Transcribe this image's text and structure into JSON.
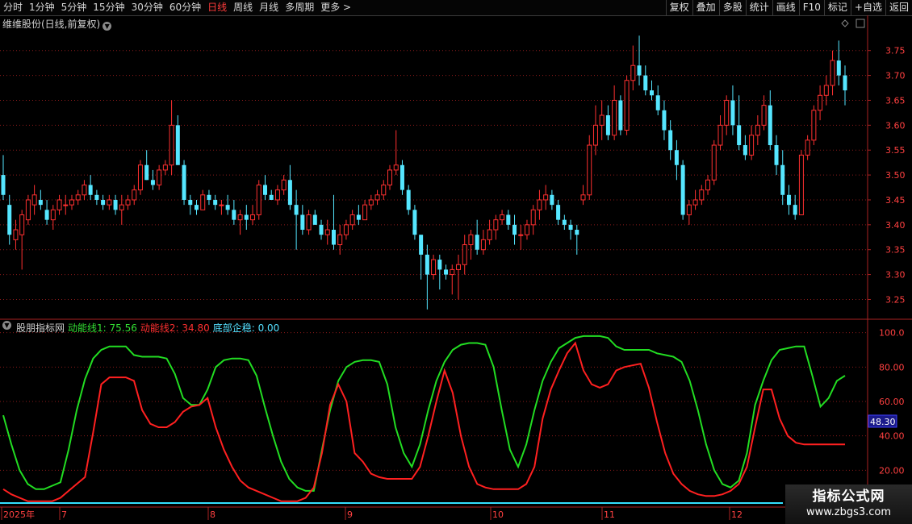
{
  "toolbar": {
    "periods": [
      "分时",
      "1分钟",
      "5分钟",
      "15分钟",
      "30分钟",
      "60分钟",
      "日线",
      "周线",
      "月线",
      "多周期",
      "更多 >"
    ],
    "active_period": "日线",
    "buttons": [
      "复权",
      "叠加",
      "多股",
      "统计",
      "画线",
      "F10",
      "标记",
      "+自选",
      "返回"
    ]
  },
  "main_chart": {
    "title": "维维股份(日线,前复权)",
    "y_ticks": [
      "3.75",
      "3.70",
      "3.65",
      "3.60",
      "3.55",
      "3.50",
      "3.45",
      "3.40",
      "3.35",
      "3.30",
      "3.25"
    ]
  },
  "indicator": {
    "name": "股朋指标网",
    "line1": "动能线1: 75.56",
    "line2": "动能线2: 34.80",
    "line3": "底部企稳: 0.00",
    "y_ticks": [
      "100.0",
      "80.00",
      "60.00",
      "40.00",
      "20.00"
    ],
    "cursor_value": "48.30"
  },
  "x_axis": {
    "labels": [
      "2025年",
      "7",
      "8",
      "9",
      "10",
      "11",
      "12"
    ]
  },
  "watermark": {
    "line1": "指标公式网",
    "line2": "www.zbgs3.com"
  },
  "colors": {
    "up": "#ff3030",
    "down": "#55e6ff",
    "line1": "#22dd22",
    "line2": "#ff2020",
    "line3": "#33e0ff",
    "grid": "#8a1a1a"
  },
  "chart_data": [
    {
      "type": "candlestick",
      "title": "维维股份(日线,前复权)",
      "ylim": [
        3.22,
        3.79
      ],
      "ohlc": [
        [
          3.5,
          3.54,
          3.45,
          3.46
        ],
        [
          3.44,
          3.46,
          3.36,
          3.38
        ],
        [
          3.37,
          3.41,
          3.35,
          3.39
        ],
        [
          3.38,
          3.43,
          3.31,
          3.42
        ],
        [
          3.41,
          3.46,
          3.4,
          3.45
        ],
        [
          3.44,
          3.48,
          3.42,
          3.46
        ],
        [
          3.45,
          3.47,
          3.43,
          3.44
        ],
        [
          3.43,
          3.45,
          3.4,
          3.41
        ],
        [
          3.41,
          3.44,
          3.39,
          3.43
        ],
        [
          3.43,
          3.46,
          3.42,
          3.45
        ],
        [
          3.44,
          3.46,
          3.42,
          3.44
        ],
        [
          3.44,
          3.46,
          3.43,
          3.45
        ],
        [
          3.45,
          3.47,
          3.44,
          3.46
        ],
        [
          3.46,
          3.49,
          3.45,
          3.48
        ],
        [
          3.48,
          3.5,
          3.45,
          3.46
        ],
        [
          3.46,
          3.47,
          3.44,
          3.45
        ],
        [
          3.45,
          3.46,
          3.43,
          3.44
        ],
        [
          3.44,
          3.46,
          3.43,
          3.45
        ],
        [
          3.45,
          3.46,
          3.42,
          3.43
        ],
        [
          3.43,
          3.46,
          3.4,
          3.44
        ],
        [
          3.44,
          3.46,
          3.43,
          3.45
        ],
        [
          3.45,
          3.48,
          3.44,
          3.47
        ],
        [
          3.47,
          3.53,
          3.46,
          3.52
        ],
        [
          3.52,
          3.55,
          3.49,
          3.49
        ],
        [
          3.49,
          3.51,
          3.47,
          3.48
        ],
        [
          3.48,
          3.52,
          3.47,
          3.51
        ],
        [
          3.51,
          3.53,
          3.5,
          3.52
        ],
        [
          3.52,
          3.65,
          3.5,
          3.6
        ],
        [
          3.6,
          3.62,
          3.52,
          3.52
        ],
        [
          3.52,
          3.53,
          3.44,
          3.45
        ],
        [
          3.45,
          3.46,
          3.42,
          3.44
        ],
        [
          3.44,
          3.45,
          3.42,
          3.43
        ],
        [
          3.43,
          3.47,
          3.43,
          3.46
        ],
        [
          3.46,
          3.47,
          3.44,
          3.45
        ],
        [
          3.45,
          3.46,
          3.43,
          3.44
        ],
        [
          3.44,
          3.45,
          3.42,
          3.44
        ],
        [
          3.44,
          3.46,
          3.42,
          3.43
        ],
        [
          3.43,
          3.45,
          3.4,
          3.41
        ],
        [
          3.41,
          3.43,
          3.38,
          3.42
        ],
        [
          3.42,
          3.44,
          3.39,
          3.41
        ],
        [
          3.41,
          3.44,
          3.4,
          3.42
        ],
        [
          3.42,
          3.49,
          3.41,
          3.48
        ],
        [
          3.48,
          3.5,
          3.45,
          3.46
        ],
        [
          3.46,
          3.47,
          3.45,
          3.45
        ],
        [
          3.45,
          3.48,
          3.44,
          3.47
        ],
        [
          3.47,
          3.5,
          3.46,
          3.49
        ],
        [
          3.49,
          3.52,
          3.43,
          3.44
        ],
        [
          3.44,
          3.47,
          3.35,
          3.42
        ],
        [
          3.42,
          3.44,
          3.38,
          3.39
        ],
        [
          3.39,
          3.43,
          3.38,
          3.42
        ],
        [
          3.42,
          3.43,
          3.4,
          3.4
        ],
        [
          3.4,
          3.41,
          3.37,
          3.38
        ],
        [
          3.38,
          3.41,
          3.36,
          3.39
        ],
        [
          3.39,
          3.46,
          3.35,
          3.36
        ],
        [
          3.36,
          3.4,
          3.34,
          3.38
        ],
        [
          3.38,
          3.41,
          3.37,
          3.4
        ],
        [
          3.4,
          3.43,
          3.39,
          3.42
        ],
        [
          3.42,
          3.44,
          3.4,
          3.41
        ],
        [
          3.41,
          3.45,
          3.41,
          3.44
        ],
        [
          3.44,
          3.46,
          3.43,
          3.45
        ],
        [
          3.45,
          3.47,
          3.44,
          3.46
        ],
        [
          3.46,
          3.49,
          3.45,
          3.48
        ],
        [
          3.48,
          3.52,
          3.47,
          3.51
        ],
        [
          3.51,
          3.59,
          3.5,
          3.52
        ],
        [
          3.52,
          3.53,
          3.46,
          3.47
        ],
        [
          3.47,
          3.48,
          3.42,
          3.43
        ],
        [
          3.43,
          3.44,
          3.37,
          3.38
        ],
        [
          3.38,
          3.38,
          3.29,
          3.34
        ],
        [
          3.34,
          3.36,
          3.23,
          3.3
        ],
        [
          3.3,
          3.34,
          3.29,
          3.33
        ],
        [
          3.33,
          3.34,
          3.27,
          3.31
        ],
        [
          3.31,
          3.32,
          3.29,
          3.3
        ],
        [
          3.3,
          3.32,
          3.26,
          3.31
        ],
        [
          3.31,
          3.34,
          3.25,
          3.32
        ],
        [
          3.32,
          3.38,
          3.3,
          3.36
        ],
        [
          3.36,
          3.39,
          3.33,
          3.38
        ],
        [
          3.38,
          3.41,
          3.34,
          3.35
        ],
        [
          3.35,
          3.39,
          3.34,
          3.37
        ],
        [
          3.37,
          3.41,
          3.36,
          3.39
        ],
        [
          3.39,
          3.42,
          3.37,
          3.41
        ],
        [
          3.41,
          3.43,
          3.4,
          3.42
        ],
        [
          3.42,
          3.43,
          3.39,
          3.4
        ],
        [
          3.4,
          3.42,
          3.36,
          3.38
        ],
        [
          3.38,
          3.4,
          3.35,
          3.38
        ],
        [
          3.38,
          3.41,
          3.37,
          3.4
        ],
        [
          3.4,
          3.44,
          3.38,
          3.43
        ],
        [
          3.43,
          3.47,
          3.41,
          3.45
        ],
        [
          3.45,
          3.48,
          3.43,
          3.46
        ],
        [
          3.46,
          3.47,
          3.43,
          3.44
        ],
        [
          3.44,
          3.45,
          3.4,
          3.41
        ],
        [
          3.41,
          3.42,
          3.39,
          3.4
        ],
        [
          3.4,
          3.41,
          3.37,
          3.39
        ],
        [
          3.39,
          3.4,
          3.34,
          3.38
        ],
        [
          3.45,
          3.48,
          3.44,
          3.46
        ],
        [
          3.46,
          3.58,
          3.45,
          3.56
        ],
        [
          3.56,
          3.64,
          3.54,
          3.6
        ],
        [
          3.6,
          3.65,
          3.57,
          3.62
        ],
        [
          3.62,
          3.64,
          3.57,
          3.58
        ],
        [
          3.58,
          3.68,
          3.57,
          3.65
        ],
        [
          3.65,
          3.66,
          3.58,
          3.59
        ],
        [
          3.59,
          3.7,
          3.58,
          3.69
        ],
        [
          3.69,
          3.76,
          3.67,
          3.72
        ],
        [
          3.72,
          3.78,
          3.68,
          3.7
        ],
        [
          3.7,
          3.72,
          3.66,
          3.67
        ],
        [
          3.67,
          3.69,
          3.65,
          3.66
        ],
        [
          3.66,
          3.68,
          3.62,
          3.63
        ],
        [
          3.63,
          3.65,
          3.57,
          3.59
        ],
        [
          3.59,
          3.61,
          3.53,
          3.55
        ],
        [
          3.55,
          3.57,
          3.49,
          3.52
        ],
        [
          3.52,
          3.53,
          3.41,
          3.42
        ],
        [
          3.42,
          3.45,
          3.4,
          3.44
        ],
        [
          3.44,
          3.47,
          3.43,
          3.45
        ],
        [
          3.45,
          3.48,
          3.44,
          3.47
        ],
        [
          3.47,
          3.5,
          3.46,
          3.49
        ],
        [
          3.49,
          3.57,
          3.48,
          3.56
        ],
        [
          3.56,
          3.62,
          3.55,
          3.6
        ],
        [
          3.6,
          3.66,
          3.58,
          3.65
        ],
        [
          3.65,
          3.68,
          3.58,
          3.6
        ],
        [
          3.6,
          3.66,
          3.55,
          3.56
        ],
        [
          3.56,
          3.58,
          3.53,
          3.54
        ],
        [
          3.54,
          3.6,
          3.53,
          3.58
        ],
        [
          3.58,
          3.62,
          3.56,
          3.6
        ],
        [
          3.6,
          3.66,
          3.59,
          3.64
        ],
        [
          3.64,
          3.67,
          3.55,
          3.56
        ],
        [
          3.56,
          3.58,
          3.5,
          3.52
        ],
        [
          3.52,
          3.55,
          3.44,
          3.46
        ],
        [
          3.46,
          3.48,
          3.42,
          3.44
        ],
        [
          3.44,
          3.46,
          3.41,
          3.42
        ],
        [
          3.42,
          3.55,
          3.42,
          3.54
        ],
        [
          3.54,
          3.58,
          3.53,
          3.57
        ],
        [
          3.57,
          3.64,
          3.56,
          3.63
        ],
        [
          3.63,
          3.68,
          3.61,
          3.66
        ],
        [
          3.66,
          3.7,
          3.64,
          3.68
        ],
        [
          3.68,
          3.75,
          3.66,
          3.73
        ],
        [
          3.73,
          3.77,
          3.68,
          3.7
        ],
        [
          3.7,
          3.72,
          3.64,
          3.67
        ]
      ],
      "y_ticks": [
        3.75,
        3.7,
        3.65,
        3.6,
        3.55,
        3.5,
        3.45,
        3.4,
        3.35,
        3.3,
        3.25
      ]
    },
    {
      "type": "line",
      "title": "股朋指标网",
      "ylim": [
        0,
        105
      ],
      "y_ticks": [
        100,
        80,
        60,
        40,
        20
      ],
      "series": [
        {
          "name": "动能线1",
          "values": [
            52,
            35,
            20,
            12,
            9,
            9,
            11,
            13,
            32,
            55,
            73,
            85,
            90,
            92,
            92,
            92,
            87,
            86,
            86,
            86,
            85,
            76,
            62,
            58,
            58,
            67,
            80,
            84,
            85,
            85,
            84,
            75,
            57,
            40,
            25,
            15,
            10,
            8,
            8,
            32,
            55,
            72,
            80,
            83,
            84,
            84,
            83,
            70,
            45,
            30,
            22,
            35,
            55,
            72,
            83,
            90,
            93,
            94,
            94,
            93,
            80,
            55,
            32,
            22,
            35,
            55,
            72,
            83,
            91,
            94,
            97,
            98,
            98,
            98,
            97,
            92,
            90,
            90,
            90,
            90,
            88,
            87,
            86,
            83,
            72,
            55,
            35,
            20,
            12,
            10,
            14,
            30,
            58,
            72,
            84,
            90,
            91,
            92,
            92,
            75,
            57,
            62,
            72,
            75
          ]
        },
        {
          "name": "动能线2",
          "values": [
            9,
            6,
            4,
            2,
            2,
            2,
            2,
            4,
            8,
            12,
            16,
            42,
            70,
            74,
            74,
            74,
            72,
            55,
            47,
            45,
            45,
            48,
            54,
            57,
            58,
            62,
            45,
            32,
            22,
            14,
            10,
            8,
            6,
            4,
            2,
            2,
            2,
            4,
            10,
            30,
            58,
            70,
            60,
            30,
            25,
            18,
            16,
            15,
            15,
            15,
            15,
            22,
            40,
            60,
            78,
            65,
            40,
            22,
            12,
            10,
            9,
            9,
            9,
            9,
            12,
            22,
            50,
            67,
            78,
            88,
            94,
            78,
            70,
            68,
            70,
            78,
            80,
            81,
            82,
            68,
            48,
            30,
            18,
            12,
            8,
            6,
            5,
            5,
            6,
            8,
            12,
            22,
            45,
            67,
            67,
            50,
            40,
            36,
            35,
            35,
            35,
            35,
            35,
            35
          ]
        },
        {
          "name": "底部企稳",
          "values": [
            0
          ]
        }
      ]
    }
  ]
}
